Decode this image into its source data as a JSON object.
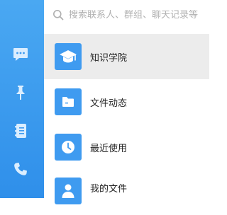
{
  "search": {
    "placeholder": "搜索联系人、群组、聊天记录等"
  },
  "sidebar": {
    "items": [
      {
        "icon": "chat-bubble-icon"
      },
      {
        "icon": "pin-icon"
      },
      {
        "icon": "address-book-icon"
      },
      {
        "icon": "phone-icon"
      }
    ]
  },
  "list": {
    "items": [
      {
        "label": "知识学院",
        "icon": "graduation-cap-icon",
        "active": true
      },
      {
        "label": "文件动态",
        "icon": "folder-icon",
        "active": false
      },
      {
        "label": "最近使用",
        "icon": "clock-icon",
        "active": false
      },
      {
        "label": "我的文件",
        "icon": "user-icon",
        "active": false
      }
    ]
  },
  "colors": {
    "sidebar": "#3b9cf0",
    "accent": "#3f9bf0",
    "active_row": "#ececec"
  }
}
